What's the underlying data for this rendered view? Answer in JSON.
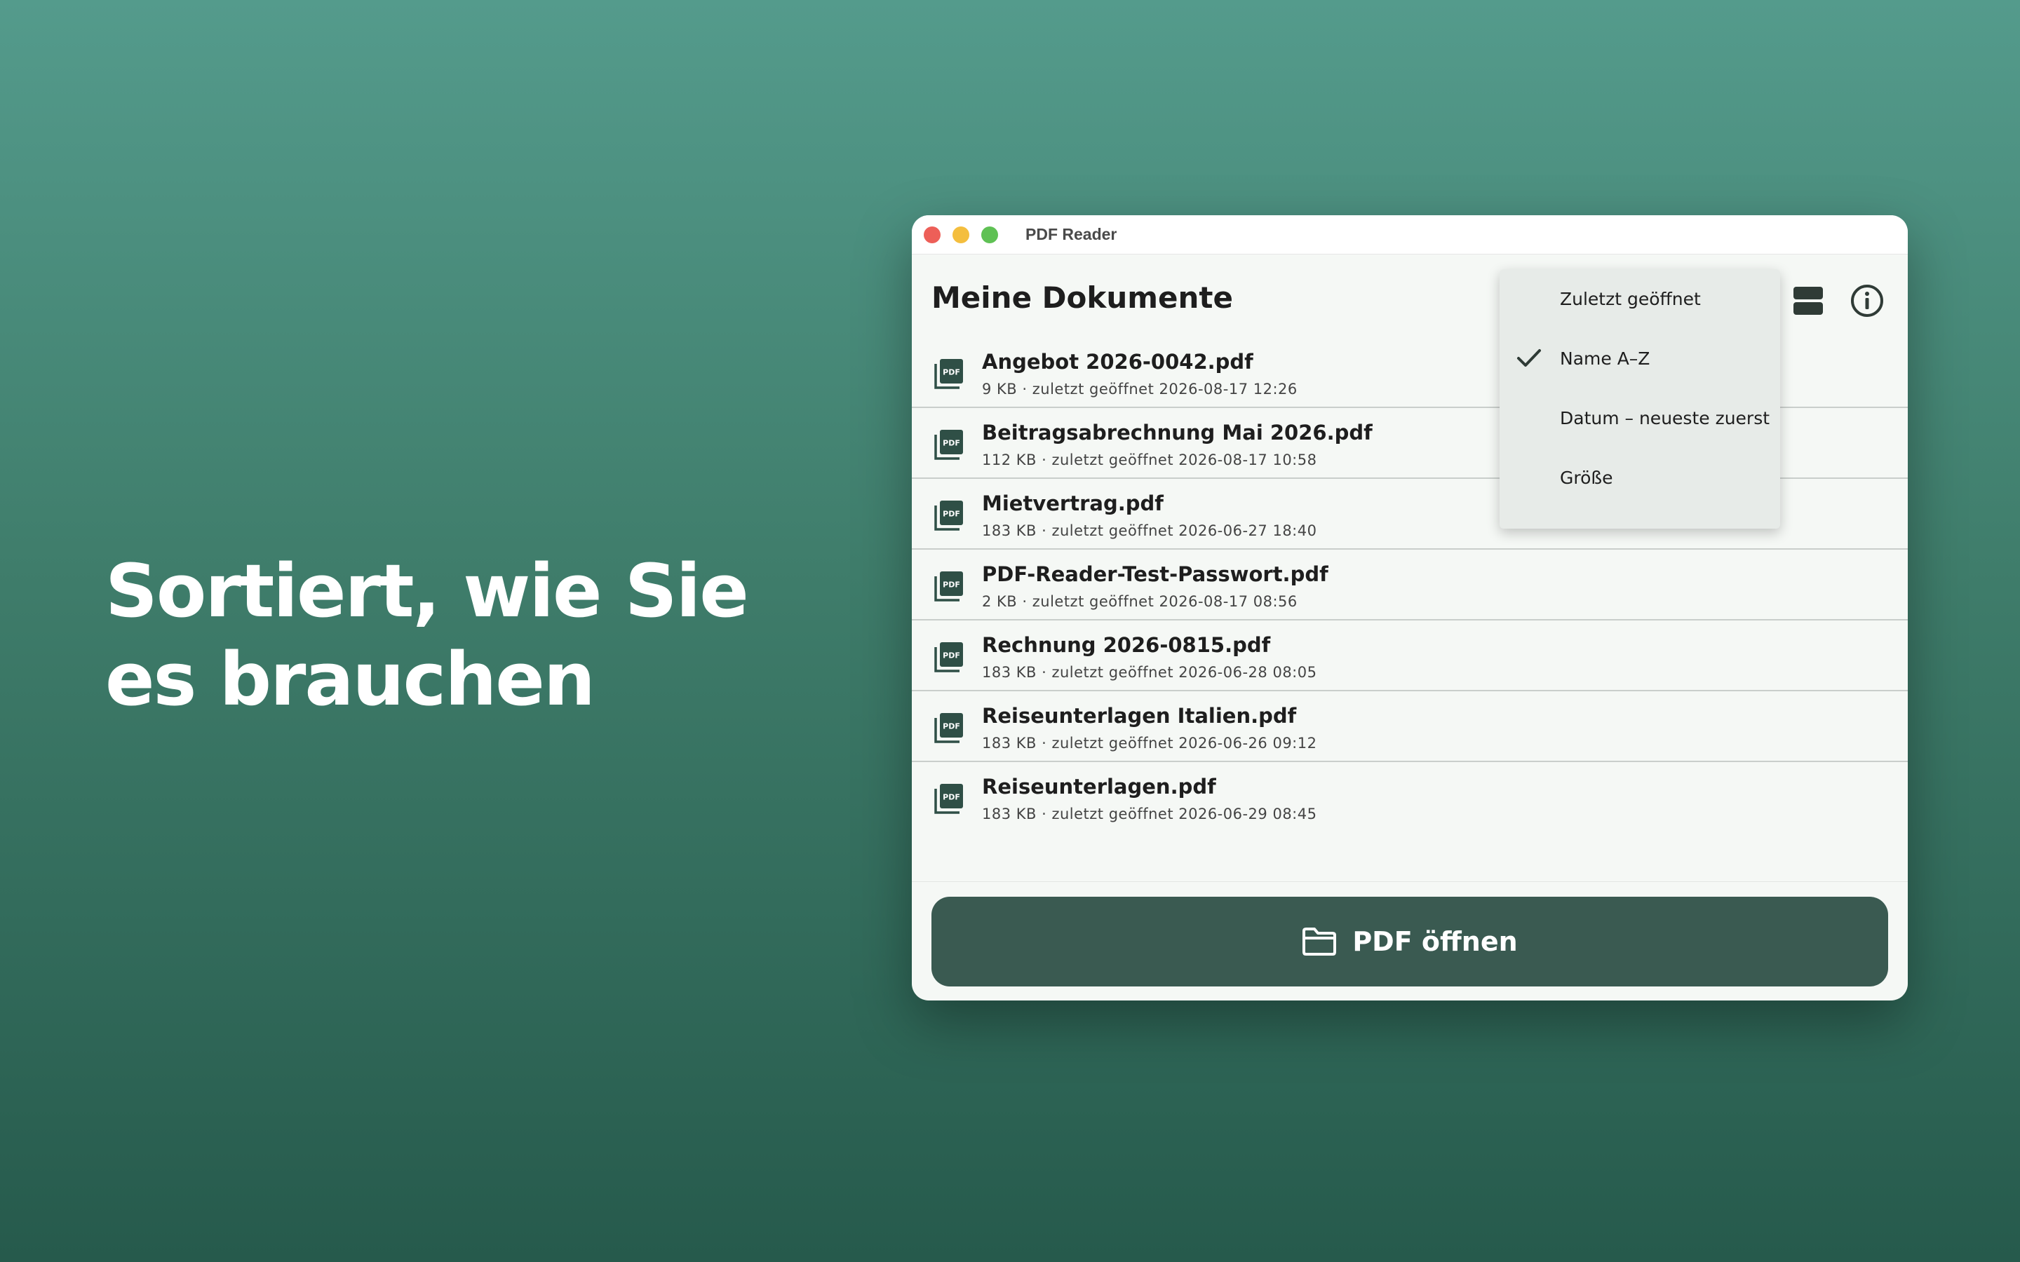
{
  "hero": {
    "headline": "Sortiert, wie Sie es brauchen"
  },
  "window": {
    "title": "PDF Reader",
    "page_title": "Meine Dokumente",
    "toolbar": {
      "layout_icon": "view-layout-icon",
      "info_icon": "info-icon"
    }
  },
  "sort_menu": {
    "selected": "Name A–Z",
    "items": [
      {
        "label": "Zuletzt geöffnet",
        "checked": false
      },
      {
        "label": "Name A–Z",
        "checked": true
      },
      {
        "label": "Datum – neueste zuerst",
        "checked": false
      },
      {
        "label": "Größe",
        "checked": false
      }
    ]
  },
  "documents": [
    {
      "name": "Angebot 2026-0042.pdf",
      "meta": "9 KB · zuletzt geöffnet 2026-08-17 12:26"
    },
    {
      "name": "Beitragsabrechnung Mai 2026.pdf",
      "meta": "112 KB · zuletzt geöffnet 2026-08-17 10:58"
    },
    {
      "name": "Mietvertrag.pdf",
      "meta": "183 KB · zuletzt geöffnet 2026-06-27 18:40"
    },
    {
      "name": "PDF-Reader-Test-Passwort.pdf",
      "meta": "2 KB · zuletzt geöffnet 2026-08-17 08:56"
    },
    {
      "name": "Rechnung 2026-0815.pdf",
      "meta": "183 KB · zuletzt geöffnet 2026-06-28 08:05"
    },
    {
      "name": "Reiseunterlagen Italien.pdf",
      "meta": "183 KB · zuletzt geöffnet 2026-06-26 09:12"
    },
    {
      "name": "Reiseunterlagen.pdf",
      "meta": "183 KB · zuletzt geöffnet 2026-06-29 08:45"
    }
  ],
  "open_button": {
    "label": "PDF öffnen",
    "icon": "folder-icon"
  },
  "colors": {
    "accent": "#3a5a51",
    "background_top": "#549b8c",
    "background_bottom": "#265a4c",
    "window_bg": "#f5f8f5",
    "menu_bg": "#e7ebe8"
  }
}
